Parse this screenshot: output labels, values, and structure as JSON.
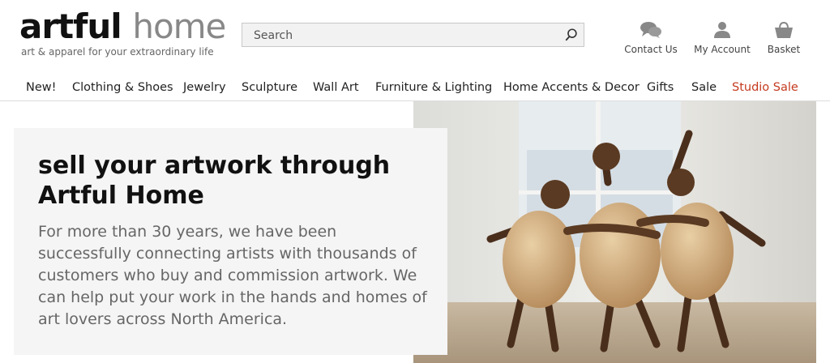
{
  "logo": {
    "word1": "artful",
    "word2": "home",
    "tagline": "art & apparel for your extraordinary life"
  },
  "search": {
    "placeholder": "Search",
    "value": ""
  },
  "utility": {
    "contact": "Contact Us",
    "account": "My Account",
    "basket": "Basket"
  },
  "nav": [
    "New!",
    "Clothing & Shoes",
    "Jewelry",
    "Sculpture",
    "Wall Art",
    "Furniture & Lighting",
    "Home Accents & Decor",
    "Gifts",
    "Sale",
    "Studio Sale"
  ],
  "hero": {
    "title": "sell your artwork through Artful Home",
    "body": "For more than 30 years, we have been successfully connecting artists with thousands of customers who buy and commission artwork. We can help put your work in the hands and homes of art lovers across North America."
  },
  "colors": {
    "accent_sale": "#c53a1f",
    "logo_gray": "#888888"
  }
}
